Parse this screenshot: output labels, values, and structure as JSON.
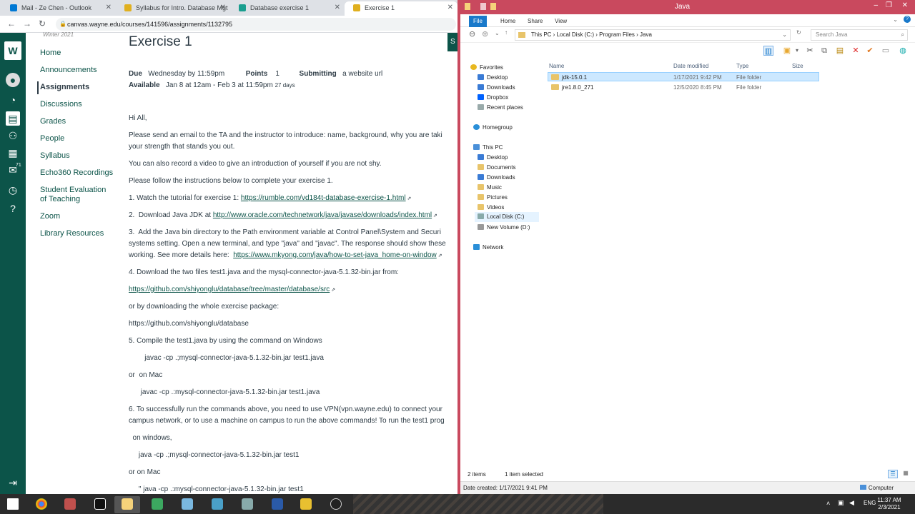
{
  "browser": {
    "tabs": [
      {
        "label": "Mail - Ze Chen - Outlook",
        "color": "#0078d4",
        "active": false
      },
      {
        "label": "Syllabus for Intro. Database Mgt",
        "color": "#e0b020",
        "active": false
      },
      {
        "label": "Database exercise 1",
        "color": "#1a9e8f",
        "active": false
      },
      {
        "label": "Exercise 1",
        "color": "#e0b020",
        "active": true
      }
    ],
    "url": "canvas.wayne.edu/courses/141596/assignments/1132795",
    "term": "Winter 2021",
    "course_nav": [
      {
        "label": "Home",
        "active": false
      },
      {
        "label": "Announcements",
        "active": false
      },
      {
        "label": "Assignments",
        "active": true
      },
      {
        "label": "Discussions",
        "active": false
      },
      {
        "label": "Grades",
        "active": false
      },
      {
        "label": "People",
        "active": false
      },
      {
        "label": "Syllabus",
        "active": false
      },
      {
        "label": "Echo360 Recordings",
        "active": false
      },
      {
        "label": "Student Evaluation",
        "active": false
      },
      {
        "label": "of Teaching",
        "active": false
      },
      {
        "label": "Zoom",
        "active": false
      },
      {
        "label": "Library Resources",
        "active": false
      }
    ],
    "badge_count": "71"
  },
  "assignment": {
    "title": "Exercise 1",
    "due_label": "Due",
    "due_value": "Wednesday by 11:59pm",
    "points_label": "Points",
    "points_value": "1",
    "submitting_label": "Submitting",
    "submitting_value": "a website url",
    "available_label": "Available",
    "available_value": "Jan 8 at 12am - Feb 3 at 11:59pm",
    "available_days": "27 days",
    "lines": [
      {
        "text": "Hi All,",
        "link": ""
      },
      {
        "text": "Please send an email to the TA and the instructor to introduce: name, background, why you are taki",
        "link": ""
      },
      {
        "text": "your strength that stands you out.",
        "link": ""
      },
      {
        "text": "You can also record a video to give an introduction of yourself if you are not shy.",
        "link": ""
      },
      {
        "text": "Please follow the instructions below to complete your exercise 1.",
        "link": ""
      },
      {
        "text": "1. Watch the tutorial for exercise 1: ",
        "link": "https://rumble.com/vd184t-database-exercise-1.html"
      },
      {
        "text": "2.  Download Java JDK at ",
        "link": "http://www.oracle.com/technetwork/java/javase/downloads/index.html"
      },
      {
        "text": "3.  Add the Java bin directory to the Path environment variable at Control Panel\\System and Securi",
        "link": ""
      },
      {
        "text": "systems setting. Open a new terminal, and type \"java\" and \"javac\". The response should show these",
        "link": ""
      },
      {
        "text": "working. See more details here:  ",
        "link": "https://www.mkyong.com/java/how-to-set-java_home-on-window"
      },
      {
        "text": "4. Download the two files test1.java and the mysql-connector-java-5.1.32-bin.jar from:",
        "link": ""
      },
      {
        "text": "",
        "link": "https://github.com/shiyonglu/database/tree/master/database/src"
      },
      {
        "text": "or by downloading the whole exercise package:",
        "link": ""
      },
      {
        "text": "https://github.com/shiyonglu/database",
        "link": ""
      },
      {
        "text": "5. Compile the test1.java by using the command on Windows",
        "link": ""
      },
      {
        "text": "        javac -cp .;mysql-connector-java-5.1.32-bin.jar test1.java",
        "link": ""
      },
      {
        "text": "or  on Mac",
        "link": ""
      },
      {
        "text": "      javac -cp .:mysql-connector-java-5.1.32-bin.jar test1.java",
        "link": ""
      },
      {
        "text": "6. To successfully run the commands above, you need to use VPN(vpn.wayne.edu) to connect your",
        "link": ""
      },
      {
        "text": "campus network, or to use a machine on campus to run the above commands! To run the test1 prog",
        "link": ""
      },
      {
        "text": "  on windows,",
        "link": ""
      },
      {
        "text": "     java -cp .;mysql-connector-java-5.1.32-bin.jar test1",
        "link": ""
      },
      {
        "text": "or on Mac",
        "link": ""
      },
      {
        "text": "     \" java -cp .:mysql-connector-java-5.1.32-bin.jar test1",
        "link": ""
      }
    ]
  },
  "explorer": {
    "title": "Java",
    "ribbon_tabs": [
      "File",
      "Home",
      "Share",
      "View"
    ],
    "breadcrumb": [
      "This PC",
      "Local Disk (C:)",
      "Program Files",
      "Java"
    ],
    "search_placeholder": "Search Java",
    "columns": [
      "Name",
      "Date modified",
      "Type",
      "Size"
    ],
    "files": [
      {
        "name": "jdk-15.0.1",
        "date": "1/17/2021 9:42 PM",
        "type": "File folder",
        "selected": true
      },
      {
        "name": "jre1.8.0_271",
        "date": "12/5/2020 8:45 PM",
        "type": "File folder",
        "selected": false
      }
    ],
    "tree": {
      "favorites": "Favorites",
      "favorites_items": [
        "Desktop",
        "Downloads",
        "Dropbox",
        "Recent places"
      ],
      "homegroup": "Homegroup",
      "this_pc": "This PC",
      "this_pc_items": [
        "Desktop",
        "Documents",
        "Downloads",
        "Music",
        "Pictures",
        "Videos",
        "Local Disk (C:)",
        "New Volume (D:)"
      ],
      "network": "Network"
    },
    "status_items": "2 items",
    "status_selected": "1 item selected",
    "details": "Date created: 1/17/2021 9:41 PM",
    "details_right": "Computer"
  },
  "taskbar": {
    "lang": "ENG",
    "time": "11:37 AM",
    "date": "2/3/2021"
  },
  "colors": {
    "canvas_green": "#0c5449",
    "explorer_accent": "#c9495e",
    "selection": "#cce8ff"
  }
}
